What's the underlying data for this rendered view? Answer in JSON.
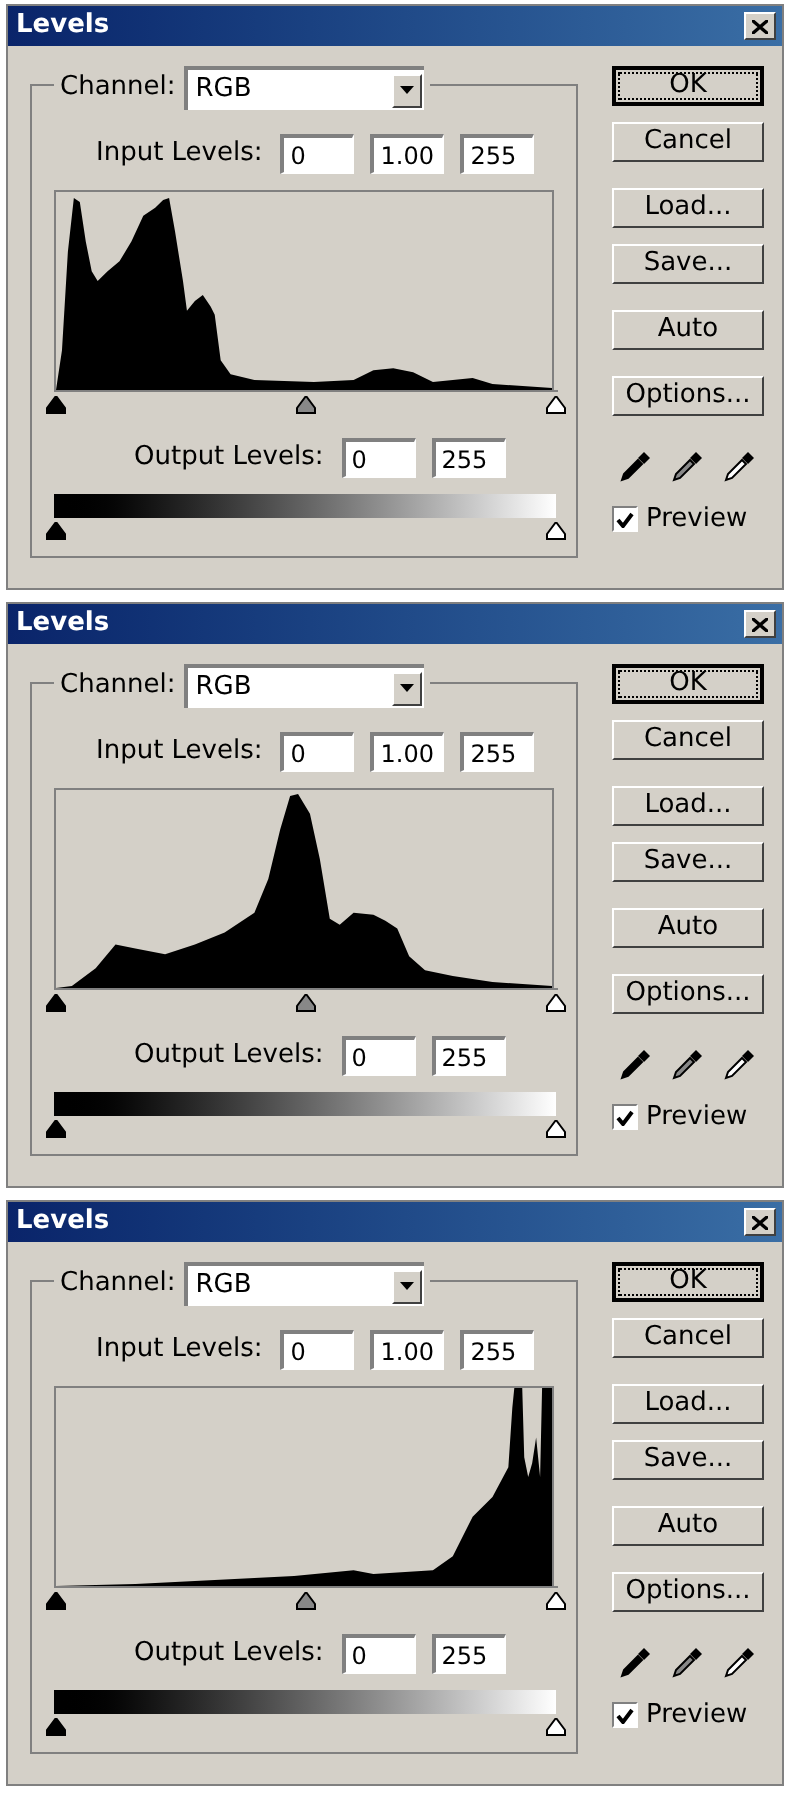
{
  "dialogs": [
    {
      "title": "Levels",
      "kind": "dark",
      "channel": {
        "label": "Channel:",
        "value": "RGB"
      },
      "input_levels": {
        "label": "Input Levels:",
        "values": [
          "0",
          "1.00",
          "255"
        ]
      },
      "output_levels": {
        "label": "Output Levels:",
        "values": [
          "0",
          "255"
        ]
      },
      "button_groups": [
        [
          {
            "label": "OK",
            "default": true
          },
          {
            "label": "Cancel",
            "default": false
          }
        ],
        [
          {
            "label": "Load...",
            "default": false
          },
          {
            "label": "Save...",
            "default": false
          }
        ],
        [
          {
            "label": "Auto",
            "default": false
          }
        ],
        [
          {
            "label": "Options...",
            "default": false
          }
        ]
      ],
      "preview": {
        "label": "Preview",
        "checked": true
      }
    },
    {
      "title": "Levels",
      "kind": "mid",
      "channel": {
        "label": "Channel:",
        "value": "RGB"
      },
      "input_levels": {
        "label": "Input Levels:",
        "values": [
          "0",
          "1.00",
          "255"
        ]
      },
      "output_levels": {
        "label": "Output Levels:",
        "values": [
          "0",
          "255"
        ]
      },
      "button_groups": [
        [
          {
            "label": "OK",
            "default": true
          },
          {
            "label": "Cancel",
            "default": false
          }
        ],
        [
          {
            "label": "Load...",
            "default": false
          },
          {
            "label": "Save...",
            "default": false
          }
        ],
        [
          {
            "label": "Auto",
            "default": false
          }
        ],
        [
          {
            "label": "Options...",
            "default": false
          }
        ]
      ],
      "preview": {
        "label": "Preview",
        "checked": true
      }
    },
    {
      "title": "Levels",
      "kind": "bright",
      "channel": {
        "label": "Channel:",
        "value": "RGB"
      },
      "input_levels": {
        "label": "Input Levels:",
        "values": [
          "0",
          "1.00",
          "255"
        ]
      },
      "output_levels": {
        "label": "Output Levels:",
        "values": [
          "0",
          "255"
        ]
      },
      "button_groups": [
        [
          {
            "label": "OK",
            "default": true
          },
          {
            "label": "Cancel",
            "default": false
          }
        ],
        [
          {
            "label": "Load...",
            "default": false
          },
          {
            "label": "Save...",
            "default": false
          }
        ],
        [
          {
            "label": "Auto",
            "default": false
          }
        ],
        [
          {
            "label": "Options...",
            "default": false
          }
        ]
      ],
      "preview": {
        "label": "Preview",
        "checked": true
      }
    }
  ]
}
